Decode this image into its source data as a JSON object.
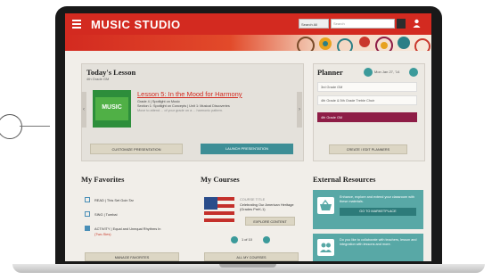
{
  "app": {
    "brand": "MUSIC STUDIO"
  },
  "header": {
    "search_scope": "Search All",
    "search_placeholder": "Search"
  },
  "todays_lesson": {
    "title": "Today's Lesson",
    "grade": "4th Grade GM",
    "thumbnail_label": "MUSIC",
    "lesson_link": "Lesson 5: In the Mood for Harmony",
    "meta_lines": [
      "Grade 4 | Spotlight on Music",
      "Section 1: Spotlight on Concepts | Unit 1: Musical Discoveries",
      "Move to attend ... of your grade on a ... harmonic pattern."
    ],
    "customize_button": "CUSTOMIZE PRESENTATION",
    "launch_button": "LAUNCH PRESENTATION"
  },
  "planner": {
    "title": "Planner",
    "date": "Mon Jan 27, '14",
    "items": [
      {
        "label": "3rd Grade GM",
        "active": false
      },
      {
        "label": "4th Grade & 5th Grade Treble Choir",
        "active": false
      },
      {
        "label": "4th Grade GM",
        "active": true
      }
    ],
    "create_button": "CREATE / EDIT PLANNERS"
  },
  "favorites": {
    "title": "My Favorites",
    "items": [
      "READ | This Set Goin Tar",
      "SING | Tumbai",
      "ACTIVITY | Equal and Unequal Rhythms In"
    ],
    "sub_link": "(Two-Sies)",
    "manage_button": "MANAGE FAVORITES"
  },
  "courses": {
    "title": "My Courses",
    "course_type": "COURSE TITLE",
    "course_name": "Celebrating Our American Heritage (Grades PreK-1)",
    "explore_button": "EXPLORE CONTENT",
    "pager": "1 of 10",
    "all_button": "ALL MY COURSES"
  },
  "external": {
    "title": "External Resources",
    "card1_text": "Enhance, explore and extend your classroom with these materials.",
    "card1_button": "GO TO MARKETPLACE",
    "card2_text": "Do you like to collaborate with teachers, lesson and integration with lessons and more."
  },
  "colors": {
    "brand_red": "#d32a20",
    "teal": "#3d8e96",
    "planner_active": "#8e1d46",
    "ext_card": "#58a8a6"
  }
}
